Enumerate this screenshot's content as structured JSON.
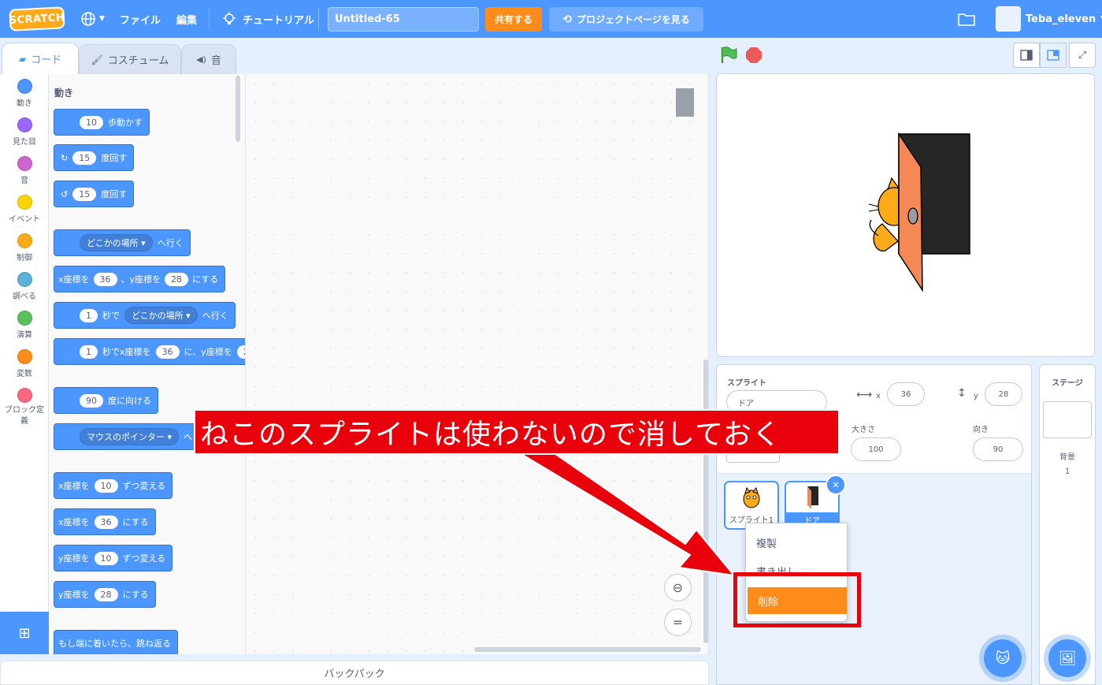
{
  "menubar": {
    "logo": "SCRATCH",
    "file": "ファイル",
    "edit": "編集",
    "tutorial": "チュートリアル",
    "project_title": "Untitled-65",
    "share": "共有する",
    "project_page": "プロジェクトページを見る",
    "username": "Teba_eleven"
  },
  "tabs": {
    "code": "コード",
    "costume": "コスチューム",
    "sound": "音"
  },
  "categories": [
    {
      "label": "動き",
      "color": "#4c97ff"
    },
    {
      "label": "見た目",
      "color": "#9966ff"
    },
    {
      "label": "音",
      "color": "#cf63cf"
    },
    {
      "label": "イベント",
      "color": "#ffd500"
    },
    {
      "label": "制御",
      "color": "#ffab19"
    },
    {
      "label": "調べる",
      "color": "#5cb1d6"
    },
    {
      "label": "演算",
      "color": "#59c059"
    },
    {
      "label": "変数",
      "color": "#ff8c1a"
    },
    {
      "label": "ブロック定義",
      "color": "#ff6680"
    }
  ],
  "palette": {
    "section": "動き",
    "blocks": {
      "move": {
        "n": "10",
        "t": "歩動かす"
      },
      "turn_cw": {
        "n": "15",
        "t": "度回す"
      },
      "turn_ccw": {
        "n": "15",
        "t": "度回す"
      },
      "goto": {
        "d": "どこかの場所",
        "t": "へ行く"
      },
      "gotoxy": {
        "t1": "x座標を",
        "x": "36",
        "t2": "、y座標を",
        "y": "28",
        "t3": "にする"
      },
      "glide": {
        "n": "1",
        "t1": "秒で",
        "d": "どこかの場所",
        "t2": "へ行く"
      },
      "glidexy": {
        "n": "1",
        "t1": "秒でx座標を",
        "x": "36",
        "t2": "に、y座標を",
        "y": "2"
      },
      "point": {
        "n": "90",
        "t": "度に向ける"
      },
      "pointto": {
        "d": "マウスのポインター",
        "t": "へ"
      },
      "changex": {
        "t1": "x座標を",
        "n": "10",
        "t2": "ずつ変える"
      },
      "setx": {
        "t1": "x座標を",
        "n": "36",
        "t2": "にする"
      },
      "changey": {
        "t1": "y座標を",
        "n": "10",
        "t2": "ずつ変える"
      },
      "sety": {
        "t1": "y座標を",
        "n": "28",
        "t2": "にする"
      },
      "bounce": {
        "t": "もし端に着いたら、跳ね返る"
      }
    }
  },
  "backpack": "バックパック",
  "sprite_info": {
    "sprite_label": "スプライト",
    "sprite_name": "ドア",
    "x_label": "x",
    "x": "36",
    "y_label": "y",
    "y": "28",
    "size_label": "大きさ",
    "size": "100",
    "direction_label": "向き",
    "direction": "90"
  },
  "sprites": [
    {
      "name": "スプライト1"
    },
    {
      "name": "ドア"
    }
  ],
  "context_menu": {
    "duplicate": "複製",
    "export": "書き出し",
    "delete": "削除"
  },
  "stage_pane": {
    "title": "ステージ",
    "backdrop_label": "背景",
    "backdrop_count": "1"
  },
  "annotation": {
    "text": "ねこのスプライトは使わないので消しておく",
    "color": "#e8000b"
  }
}
